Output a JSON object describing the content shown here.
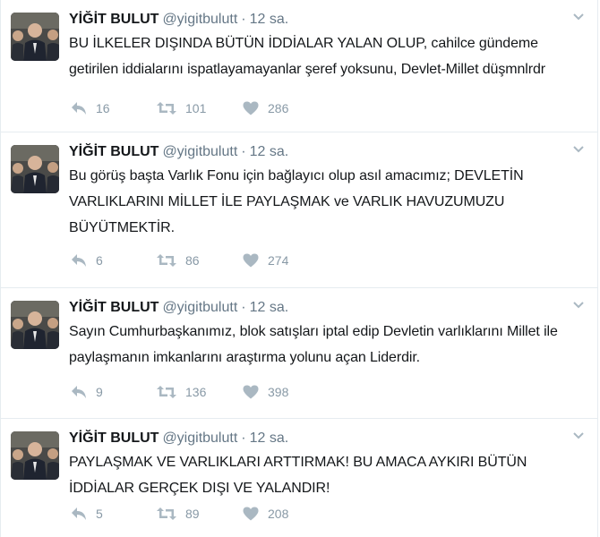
{
  "colors": {
    "text": "#14171a",
    "muted": "#657786",
    "action_icon": "#aab8c2",
    "divider": "#e6ecf0"
  },
  "icons": {
    "reply": "reply-icon",
    "retweet": "retweet-icon",
    "like": "heart-icon",
    "more": "chevron-down-icon"
  },
  "tweets": [
    {
      "fullname": "YİĞİT BULUT",
      "username": "@yigitbulutt",
      "dot": "·",
      "time": "12 sa.",
      "text": "BU İLKELER DIŞINDA BÜTÜN İDDİALAR YALAN OLUP, cahilce gündeme getirilen iddialarını ispatlayamayanlar şeref yoksunu, Devlet-Millet düşmnlrdr",
      "replies": "16",
      "retweets": "101",
      "likes": "286"
    },
    {
      "fullname": "YİĞİT BULUT",
      "username": "@yigitbulutt",
      "dot": "·",
      "time": "12 sa.",
      "text": "Bu görüş başta Varlık Fonu için bağlayıcı olup asıl amacımız; DEVLETİN VARLIKLARINI MİLLET İLE PAYLAŞMAK ve VARLIK HAVUZUMUZU BÜYÜTMEKTİR.",
      "replies": "6",
      "retweets": "86",
      "likes": "274"
    },
    {
      "fullname": "YİĞİT BULUT",
      "username": "@yigitbulutt",
      "dot": "·",
      "time": "12 sa.",
      "text": "Sayın Cumhurbaşkanımız, blok satışları iptal edip Devletin varlıklarını Millet ile paylaşmanın imkanlarını araştırma yolunu açan Liderdir.",
      "replies": "9",
      "retweets": "136",
      "likes": "398"
    },
    {
      "fullname": "YİĞİT BULUT",
      "username": "@yigitbulutt",
      "dot": "·",
      "time": "12 sa.",
      "text": "PAYLAŞMAK VE VARLIKLARI ARTTIRMAK! BU AMACA AYKIRI BÜTÜN İDDİALAR GERÇEK DIŞI VE YALANDIR!",
      "replies": "5",
      "retweets": "89",
      "likes": "208"
    }
  ]
}
